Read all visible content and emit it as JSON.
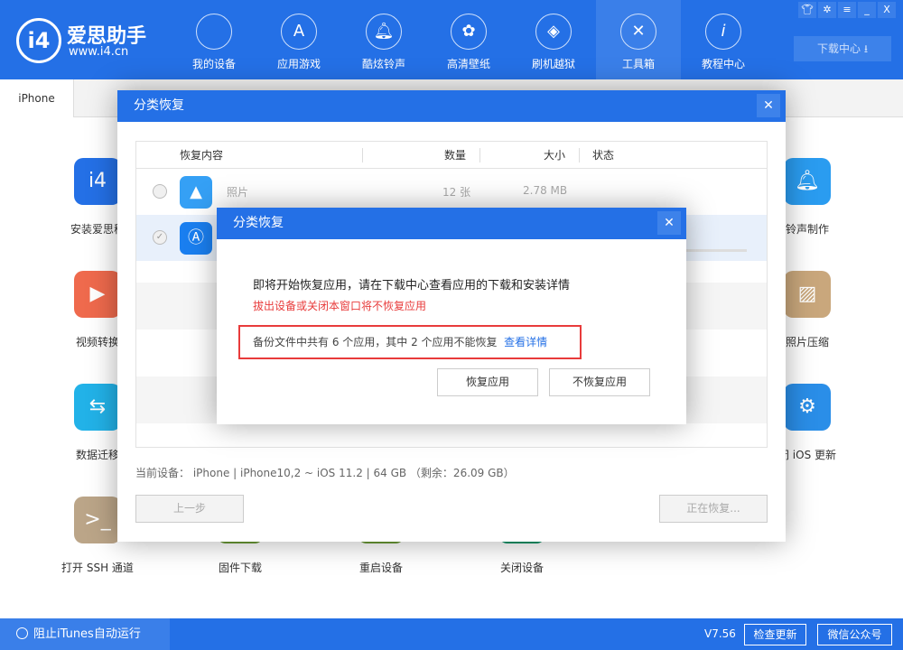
{
  "header": {
    "brand": "爱思助手",
    "url": "www.i4.cn",
    "logo_text": "i4",
    "nav": [
      {
        "label": "我的设备",
        "icon": "apple-icon"
      },
      {
        "label": "应用游戏",
        "icon": "app-store-icon"
      },
      {
        "label": "酷炫铃声",
        "icon": "bell-icon"
      },
      {
        "label": "高清壁纸",
        "icon": "flower-icon"
      },
      {
        "label": "刷机越狱",
        "icon": "dropbox-icon"
      },
      {
        "label": "工具箱",
        "icon": "tools-icon"
      },
      {
        "label": "教程中心",
        "icon": "info-icon"
      }
    ],
    "active_nav": "工具箱",
    "download_center": "下载中心"
  },
  "tabs": [
    "iPhone"
  ],
  "tools": [
    "安装爱思移",
    "视频转换",
    "数据迁移",
    "打开 SSH 通道",
    "固件下载",
    "重启设备",
    "关闭设备",
    "铃声制作",
    "照片压缩",
    "闭 iOS 更新"
  ],
  "dialog": {
    "title": "分类恢复",
    "columns": [
      "恢复内容",
      "数量",
      "大小",
      "状态"
    ],
    "rows": [
      {
        "name": "照片",
        "count": "12 张",
        "size": "2.78 MB",
        "checked": false
      },
      {
        "name": "",
        "count": "",
        "size": "",
        "checked": true
      }
    ],
    "device_info": "当前设备： iPhone   |   iPhone10,2 ~ iOS 11.2   |   64 GB （剩余：26.09 GB）",
    "back": "上一步",
    "restoring": "正在恢复..."
  },
  "confirm": {
    "title": "分类恢复",
    "message": "即将开始恢复应用，请在下载中心查看应用的下载和安装详情",
    "warning": "拔出设备或关闭本窗口将不恢复应用",
    "note": "备份文件中共有 6 个应用，其中 2 个应用不能恢复",
    "details_link": "查看详情",
    "restore": "恢复应用",
    "no_restore": "不恢复应用",
    "accent": "#2470e6",
    "warning_color": "#e83b3b"
  },
  "footer": {
    "block_itunes": "阻止iTunes自动运行",
    "version": "V7.56",
    "check_update": "检查更新",
    "wechat": "微信公众号"
  }
}
